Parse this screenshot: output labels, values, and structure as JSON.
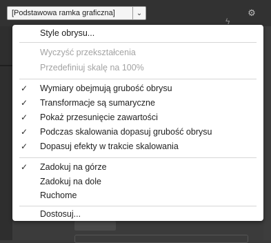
{
  "toolbar": {
    "frame_style_value": "[Podstawowa ramka graficzna]",
    "caret_glyph": "⌄",
    "gear_glyph": "⚙",
    "bolt_glyph": "ϟ"
  },
  "menu": {
    "items": [
      {
        "label": "Style obrysu...",
        "checked": false,
        "enabled": true
      },
      {
        "label": "Wyczyść przekształcenia",
        "checked": false,
        "enabled": false
      },
      {
        "label": "Przedefiniuj skalę na 100%",
        "checked": false,
        "enabled": false
      },
      {
        "label": "Wymiary obejmują grubość obrysu",
        "checked": true,
        "enabled": true
      },
      {
        "label": "Transformacje są sumaryczne",
        "checked": true,
        "enabled": true
      },
      {
        "label": "Pokaż przesunięcie zawartości",
        "checked": true,
        "enabled": true
      },
      {
        "label": "Podczas skalowania dopasuj grubość obrysu",
        "checked": true,
        "enabled": true
      },
      {
        "label": "Dopasuj efekty w trakcie skalowania",
        "checked": true,
        "enabled": true
      },
      {
        "label": "Zadokuj na górze",
        "checked": true,
        "enabled": true
      },
      {
        "label": "Zadokuj na dole",
        "checked": false,
        "enabled": true
      },
      {
        "label": "Ruchome",
        "checked": false,
        "enabled": true
      },
      {
        "label": "Dostosuj...",
        "checked": false,
        "enabled": true
      }
    ],
    "check_glyph": "✓"
  },
  "colors": {
    "menu_bg": "#ffffff",
    "disabled_text": "#a3a3a3",
    "app_bg": "#3a3a3a"
  }
}
